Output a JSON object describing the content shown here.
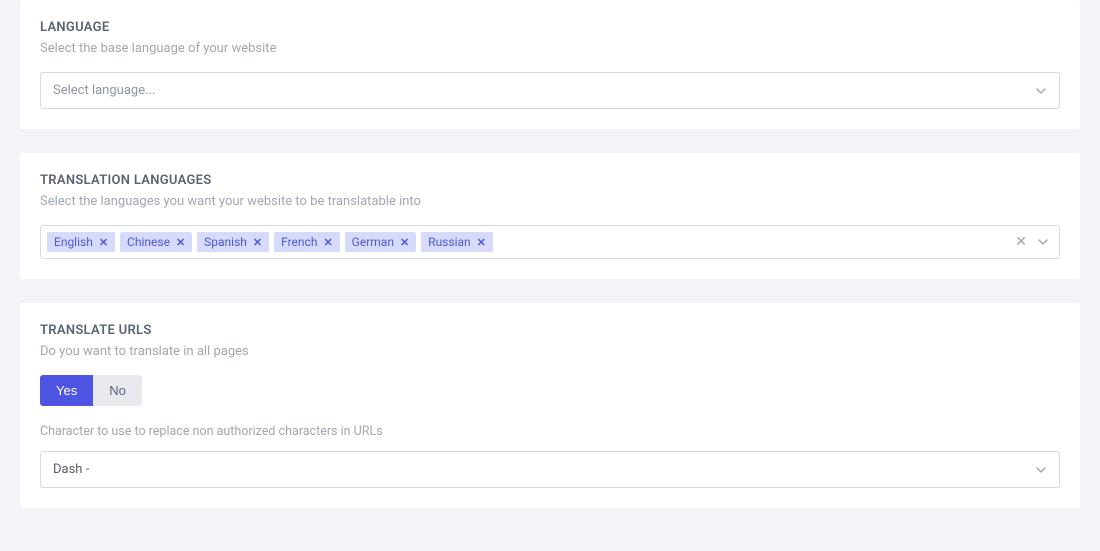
{
  "language": {
    "title": "LANGUAGE",
    "subtitle": "Select the base language of your website",
    "placeholder": "Select language..."
  },
  "translation": {
    "title": "TRANSLATION LANGUAGES",
    "subtitle": "Select the languages you want your website to be translatable into",
    "tags": [
      "English",
      "Chinese",
      "Spanish",
      "French",
      "German",
      "Russian"
    ]
  },
  "urls": {
    "title": "TRANSLATE URLS",
    "subtitle": "Do you want to translate in all pages",
    "yes": "Yes",
    "no": "No",
    "char_label": "Character to use to replace non authorized characters in URLs",
    "char_value": "Dash -"
  }
}
